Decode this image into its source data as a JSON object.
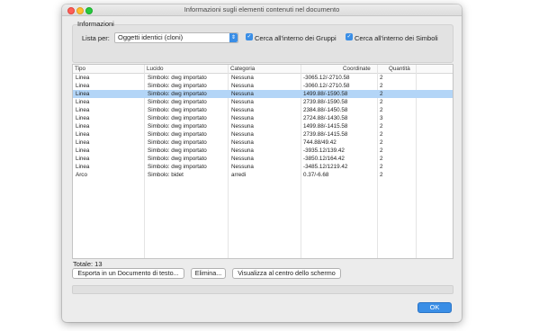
{
  "window": {
    "title": "Informazioni sugli elementi contenuti nel documento"
  },
  "info": {
    "group_title": "Informazioni",
    "lista_label": "Lista per:",
    "lista_value": "Oggetti identici (cloni)",
    "check_gruppi": {
      "label": "Cerca all'interno dei Gruppi",
      "checked": true
    },
    "check_simboli": {
      "label": "Cerca all'interno dei Simboli",
      "checked": true
    }
  },
  "table": {
    "columns": [
      "Tipo",
      "Lucido",
      "Categoria",
      "Coordinate",
      "Quantità"
    ],
    "rows": [
      {
        "tipo": "Linea",
        "lucido": "Simbolo: dwg importato",
        "categoria": "Nessuna",
        "coordinate": "-3065.12/-2710.58",
        "quantita": "2",
        "selected": false
      },
      {
        "tipo": "Linea",
        "lucido": "Simbolo: dwg importato",
        "categoria": "Nessuna",
        "coordinate": "-3060.12/-2710.58",
        "quantita": "2",
        "selected": false
      },
      {
        "tipo": "Linea",
        "lucido": "Simbolo: dwg importato",
        "categoria": "Nessuna",
        "coordinate": "1499.88/-1590.58",
        "quantita": "2",
        "selected": true
      },
      {
        "tipo": "Linea",
        "lucido": "Simbolo: dwg importato",
        "categoria": "Nessuna",
        "coordinate": "2739.88/-1590.58",
        "quantita": "2",
        "selected": false
      },
      {
        "tipo": "Linea",
        "lucido": "Simbolo: dwg importato",
        "categoria": "Nessuna",
        "coordinate": "2384.88/-1450.58",
        "quantita": "2",
        "selected": false
      },
      {
        "tipo": "Linea",
        "lucido": "Simbolo: dwg importato",
        "categoria": "Nessuna",
        "coordinate": "2724.88/-1430.58",
        "quantita": "3",
        "selected": false
      },
      {
        "tipo": "Linea",
        "lucido": "Simbolo: dwg importato",
        "categoria": "Nessuna",
        "coordinate": "1499.88/-1415.58",
        "quantita": "2",
        "selected": false
      },
      {
        "tipo": "Linea",
        "lucido": "Simbolo: dwg importato",
        "categoria": "Nessuna",
        "coordinate": "2739.88/-1415.58",
        "quantita": "2",
        "selected": false
      },
      {
        "tipo": "Linea",
        "lucido": "Simbolo: dwg importato",
        "categoria": "Nessuna",
        "coordinate": "744.88/49.42",
        "quantita": "2",
        "selected": false
      },
      {
        "tipo": "Linea",
        "lucido": "Simbolo: dwg importato",
        "categoria": "Nessuna",
        "coordinate": "-3935.12/139.42",
        "quantita": "2",
        "selected": false
      },
      {
        "tipo": "Linea",
        "lucido": "Simbolo: dwg importato",
        "categoria": "Nessuna",
        "coordinate": "-3850.12/164.42",
        "quantita": "2",
        "selected": false
      },
      {
        "tipo": "Linea",
        "lucido": "Simbolo: dwg importato",
        "categoria": "Nessuna",
        "coordinate": "-3485.12/1219.42",
        "quantita": "2",
        "selected": false
      },
      {
        "tipo": "Arco",
        "lucido": "Simbolo: bidet",
        "categoria": "arredi",
        "coordinate": "0.37/-6.68",
        "quantita": "2",
        "selected": false
      }
    ]
  },
  "totale": "Totale: 13",
  "buttons": {
    "esporta": "Esporta in un Documento di testo...",
    "elimina": "Elimina...",
    "visualizza": "Visualizza al centro dello schermo",
    "ok": "OK"
  },
  "colors": {
    "accent": "#3a8ee6",
    "selection": "#b3d5f7"
  }
}
